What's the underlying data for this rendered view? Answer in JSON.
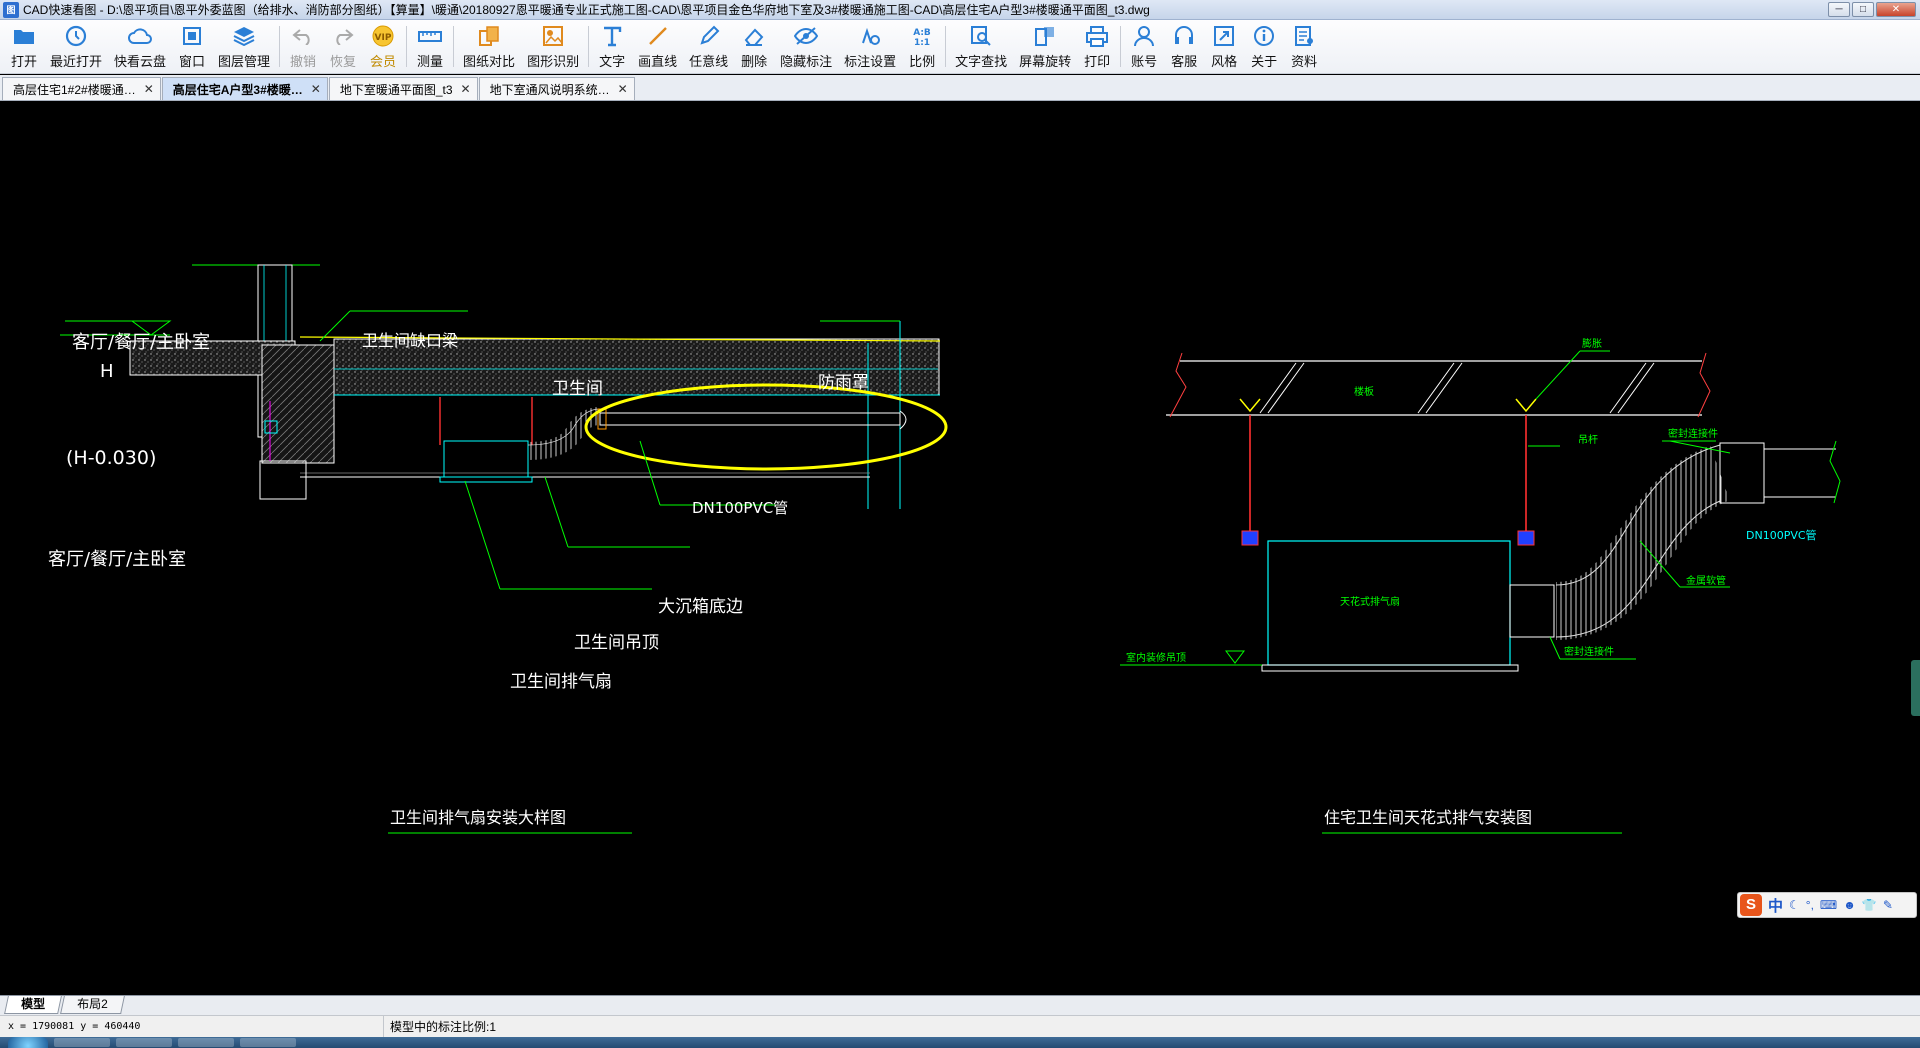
{
  "window": {
    "icon_label": "图",
    "title": "CAD快速看图 - D:\\恩平项目\\恩平外委蓝图（给排水、消防部分图纸）【算量】\\暖通\\20180927恩平暖通专业正式施工图-CAD\\恩平项目金色华府地下室及3#楼暖通施工图-CAD\\高层住宅A户型3#楼暖通平面图_t3.dwg",
    "min": "─",
    "max": "□",
    "close": "✕"
  },
  "toolbar": [
    {
      "id": "open",
      "label": "打开",
      "icon": "folder-icon",
      "state": "normal"
    },
    {
      "id": "recent",
      "label": "最近打开",
      "icon": "clock-icon",
      "state": "normal"
    },
    {
      "id": "cloud",
      "label": "快看云盘",
      "icon": "cloud-icon",
      "state": "normal"
    },
    {
      "id": "window",
      "label": "窗口",
      "icon": "window-icon",
      "state": "normal"
    },
    {
      "id": "layers",
      "label": "图层管理",
      "icon": "layers-icon",
      "state": "normal"
    },
    {
      "id": "undo",
      "label": "撤销",
      "icon": "undo-icon",
      "state": "disabled"
    },
    {
      "id": "redo",
      "label": "恢复",
      "icon": "redo-icon",
      "state": "disabled"
    },
    {
      "id": "vip",
      "label": "会员",
      "icon": "vip-icon",
      "state": "vip"
    },
    {
      "id": "measure",
      "label": "测量",
      "icon": "ruler-icon",
      "state": "normal"
    },
    {
      "id": "compare",
      "label": "图纸对比",
      "icon": "compare-icon",
      "state": "normal"
    },
    {
      "id": "recognize",
      "label": "图形识别",
      "icon": "recognize-icon",
      "state": "normal"
    },
    {
      "id": "text",
      "label": "文字",
      "icon": "text-icon",
      "state": "normal"
    },
    {
      "id": "line",
      "label": "画直线",
      "icon": "line-icon",
      "state": "normal"
    },
    {
      "id": "freeline",
      "label": "任意线",
      "icon": "pen-icon",
      "state": "normal"
    },
    {
      "id": "erase",
      "label": "删除",
      "icon": "eraser-icon",
      "state": "normal"
    },
    {
      "id": "hide",
      "label": "隐藏标注",
      "icon": "eye-icon",
      "state": "normal"
    },
    {
      "id": "dimset",
      "label": "标注设置",
      "icon": "dim-settings-icon",
      "state": "normal"
    },
    {
      "id": "ratio",
      "label": "比例",
      "icon": "ratio-icon",
      "state": "normal"
    },
    {
      "id": "findtext",
      "label": "文字查找",
      "icon": "find-icon",
      "state": "normal"
    },
    {
      "id": "rotate",
      "label": "屏幕旋转",
      "icon": "rotate-icon",
      "state": "normal"
    },
    {
      "id": "print",
      "label": "打印",
      "icon": "printer-icon",
      "state": "normal"
    },
    {
      "id": "account",
      "label": "账号",
      "icon": "user-icon",
      "state": "normal"
    },
    {
      "id": "service",
      "label": "客服",
      "icon": "headset-icon",
      "state": "normal"
    },
    {
      "id": "style",
      "label": "风格",
      "icon": "style-icon",
      "state": "normal"
    },
    {
      "id": "about",
      "label": "关于",
      "icon": "info-icon",
      "state": "normal"
    },
    {
      "id": "docs",
      "label": "资料",
      "icon": "docs-icon",
      "state": "normal"
    }
  ],
  "tabs": [
    {
      "label": "高层住宅1#2#楼暖通…",
      "close": "✕",
      "active": false
    },
    {
      "label": "高层住宅A户型3#楼暖…",
      "close": "✕",
      "active": true
    },
    {
      "label": "地下室暖通平面图_t3",
      "close": "✕",
      "active": false
    },
    {
      "label": "地下室通风说明系统…",
      "close": "✕",
      "active": false
    }
  ],
  "drawing": {
    "left": {
      "room_top": "客厅/餐厅/主卧室",
      "elev_h": "H",
      "elev_h2": "(H-0.030)",
      "room_bottom": "客厅/餐厅/主卧室",
      "beam": "卫生间缺口梁",
      "bathroom": "卫生间",
      "rain_cover": "防雨罩",
      "pipe": "DN100PVC管",
      "sink_edge": "大沉箱底边",
      "ceiling": "卫生间吊顶",
      "fan": "卫生间排气扇",
      "caption": "卫生间排气扇安装大样图"
    },
    "right": {
      "anchor": "膨胀",
      "slab": "楼板",
      "rod": "吊杆",
      "joint_top": "密封连接件",
      "fan": "天花式排气扇",
      "pipe": "DN100PVC管",
      "metal_hose": "金属软管",
      "joint_bottom": "密封连接件",
      "ceiling": "室内装修吊顶",
      "caption": "住宅卫生间天花式排气安装图"
    }
  },
  "ime": {
    "logo": "S",
    "mode": "中",
    "glyphs": [
      "☾",
      "°,",
      "⌨",
      "☻",
      "👕",
      "✎"
    ]
  },
  "layout_tabs": [
    {
      "label": "模型",
      "active": true
    },
    {
      "label": "布局2",
      "active": false
    }
  ],
  "status": {
    "coords": "x = 1790081  y = 460440",
    "scale": "模型中的标注比例:1"
  },
  "colors": {
    "cad_green": "#00ff00",
    "cad_cyan": "#00ffff",
    "cad_yellow": "#ffff00",
    "cad_white": "#ffffff",
    "cad_red": "#ff0000",
    "toolbar_blue": "#1f78d1"
  }
}
